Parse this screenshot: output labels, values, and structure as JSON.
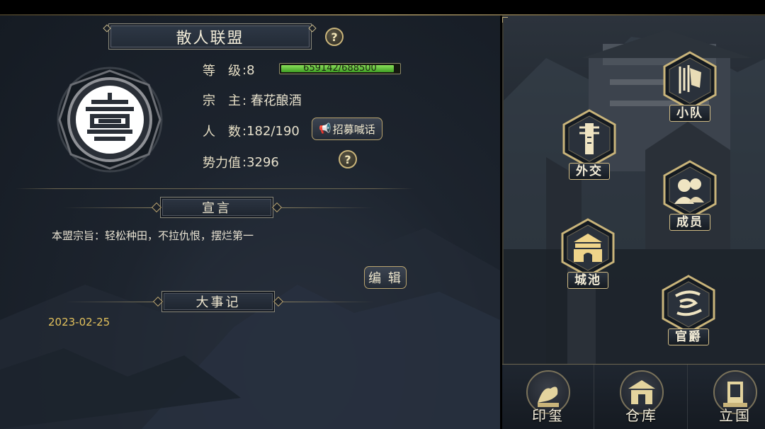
{
  "alliance": {
    "name": "散人联盟",
    "level_label": "等　级",
    "level_value": ":8",
    "xp_text": "659142/688500",
    "xp_progress": 0.957,
    "leader_label": "宗　主",
    "leader_value": ": 春花酿酒",
    "members_label": "人　数",
    "members_value": ":182/190",
    "power_label": "势力值",
    "power_value": ":3296"
  },
  "buttons": {
    "recruit": "招募喊话",
    "edit": "编 辑",
    "help": "?"
  },
  "manifesto": {
    "header": "宣言",
    "text": "本盟宗旨：轻松种田，不拉仇恨，摆烂第一"
  },
  "events": {
    "header": "大事记",
    "date": "2023-02-25"
  },
  "map_buttons": {
    "squad": "小队",
    "diplomacy": "外交",
    "members": "成员",
    "city": "城池",
    "ranks": "官爵"
  },
  "bottom_nav": {
    "seal": "印玺",
    "warehouse": "仓库",
    "found": "立国"
  },
  "colors": {
    "gold": "#c9b47a",
    "xp_green": "#5cc23a",
    "date": "#e2c15c"
  }
}
